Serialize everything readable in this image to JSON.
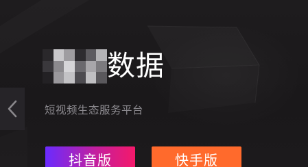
{
  "hero": {
    "title_suffix": "数据",
    "subtitle": "短视频生态服务平台"
  },
  "buttons": {
    "douyin_label": "抖音版",
    "kuaishou_label": "快手版"
  },
  "icons": {
    "prev": "chevron-left-icon"
  },
  "colors": {
    "background": "#1b191b",
    "title": "#ffffff",
    "subtitle": "#8d8b90",
    "douyin_gradient_start": "#6a2bff",
    "douyin_gradient_end": "#f4196a",
    "kuaishou": "#ff6a2c"
  }
}
